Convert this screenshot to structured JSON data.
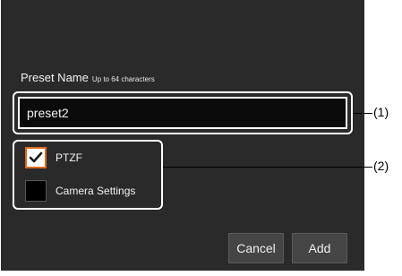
{
  "dialog": {
    "preset_name_label": "Preset Name",
    "preset_name_hint": "Up to 64 characters",
    "preset_name_value": "preset2",
    "options": [
      {
        "label": "PTZF",
        "checked": true
      },
      {
        "label": "Camera Settings",
        "checked": false
      }
    ],
    "cancel_label": "Cancel",
    "add_label": "Add"
  },
  "annotations": {
    "marker_1": "(1)",
    "marker_2": "(2)"
  },
  "colors": {
    "dialog_background": "#2a2a2a",
    "input_background": "#0b0b0b",
    "checkbox_accent": "#e06a1c",
    "button_background": "#454545"
  }
}
